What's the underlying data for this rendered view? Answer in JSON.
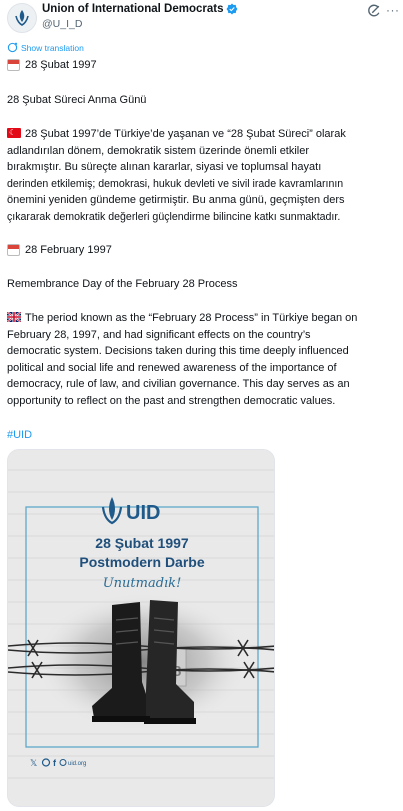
{
  "author": {
    "display_name": "Union of International Democrats",
    "handle": "@U_I_D",
    "verified": true
  },
  "header_icons": [
    "grok-icon",
    "more-icon"
  ],
  "translate_label": "Show translation",
  "post": {
    "tr_date": "28 Şubat 1997",
    "tr_title": "28 Şubat Süreci Anma Günü",
    "tr_body_lines": [
      "28 Şubat 1997’de Türkiye’de yaşanan ve “28 Şubat Süreci” olarak",
      "adlandırılan dönem, demokratik sistem üzerinde önemli etkiler",
      "bırakmıştır. Bu süreçte alınan kararlar, siyasi ve toplumsal hayatı",
      "derinden etkilemiş; demokrasi, hukuk devleti ve sivil irade kavramlarının",
      "önemini yeniden gündeme getirmiştir. Bu anma günü, geçmişten ders",
      "çıkararak demokratik değerleri güçlendirme bilincine katkı sunmaktadır."
    ],
    "en_date": "28 February 1997",
    "en_title": "Remembrance Day of the February 28 Process",
    "en_body_lines": [
      "The period known as the “February 28 Process” in Türkiye began on",
      "February 28, 1997, and had significant effects on the country’s",
      "democratic system. Decisions taken during this time deeply influenced",
      "political and social life and renewed awareness of the importance of",
      "democracy, rule of law, and civilian governance. This day serves as an",
      "opportunity to reflect on the past and strengthen democratic values."
    ],
    "hashtag": "#UID"
  },
  "media": {
    "logo_text": "UID",
    "heading_line1": "28 Şubat 1997",
    "heading_line2": "Postmodern Darbe",
    "script_text": "Unutmadık!",
    "calendar_number": "28",
    "footer_site": "uid.org",
    "brand_color": "#1f5a8a"
  }
}
